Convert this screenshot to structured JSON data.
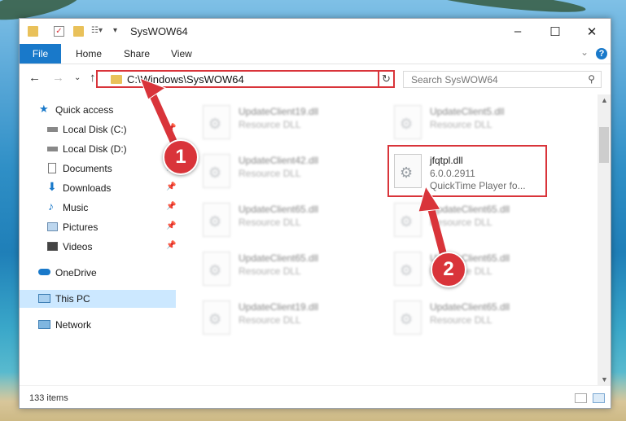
{
  "window": {
    "title": "SysWOW64"
  },
  "ribbon": {
    "file": "File",
    "tabs": [
      "Home",
      "Share",
      "View"
    ],
    "help": "?"
  },
  "address": {
    "path": "C:\\Windows\\SysWOW64",
    "refresh": "↻"
  },
  "search": {
    "placeholder": "Search SysWOW64"
  },
  "sidebar": {
    "items": [
      {
        "label": "Quick access"
      },
      {
        "label": "Local Disk (C:)"
      },
      {
        "label": "Local Disk (D:)"
      },
      {
        "label": "Documents"
      },
      {
        "label": "Downloads"
      },
      {
        "label": "Music"
      },
      {
        "label": "Pictures"
      },
      {
        "label": "Videos"
      },
      {
        "label": "OneDrive"
      },
      {
        "label": "This PC"
      },
      {
        "label": "Network"
      }
    ]
  },
  "files": [
    {
      "name": "UpdateClient19.dll",
      "type": "Resource DLL"
    },
    {
      "name": "UpdateClient5.dll",
      "type": "Resource DLL"
    },
    {
      "name": "UpdateClient42.dll",
      "type": "Resource DLL"
    },
    {
      "name": "jfqtpl.dll",
      "version": "6.0.0.2911",
      "desc": "QuickTime Player fo..."
    },
    {
      "name": "UpdateClient65.dll",
      "type": "Resource DLL"
    },
    {
      "name": "UpdateClient65.dll",
      "type": "Resource DLL"
    },
    {
      "name": "UpdateClient65.dll",
      "type": "Resource DLL"
    },
    {
      "name": "UpdateClient65.dll",
      "type": "Resource DLL"
    },
    {
      "name": "UpdateClient19.dll",
      "type": "Resource DLL"
    },
    {
      "name": "UpdateClient65.dll",
      "type": "Resource DLL"
    }
  ],
  "status": {
    "count": "133 items"
  },
  "annotations": {
    "badge1": "1",
    "badge2": "2",
    "accent": "#d9343a"
  }
}
